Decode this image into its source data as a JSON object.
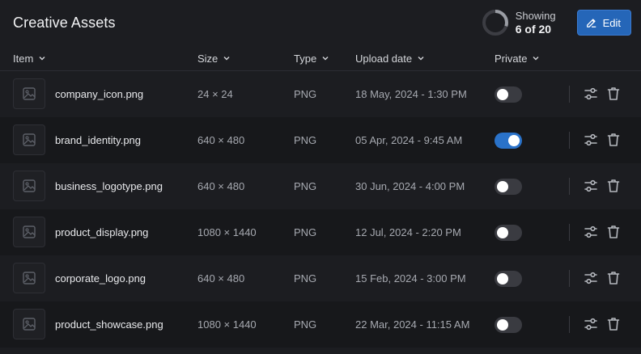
{
  "header": {
    "title": "Creative Assets",
    "progress_label": "Showing",
    "progress_value": "6 of 20",
    "progress_fraction": 0.3,
    "edit_label": "Edit"
  },
  "columns": {
    "item": "Item",
    "size": "Size",
    "type": "Type",
    "date": "Upload date",
    "private": "Private"
  },
  "colors": {
    "accent": "#2566b8",
    "toggle_on": "#2a72c9"
  },
  "rows": [
    {
      "name": "company_icon.png",
      "size": "24 × 24",
      "type": "PNG",
      "date": "18 May, 2024 - 1:30 PM",
      "private": false
    },
    {
      "name": "brand_identity.png",
      "size": "640 × 480",
      "type": "PNG",
      "date": "05 Apr, 2024 - 9:45 AM",
      "private": true
    },
    {
      "name": "business_logotype.png",
      "size": "640 × 480",
      "type": "PNG",
      "date": "30 Jun, 2024 - 4:00 PM",
      "private": false
    },
    {
      "name": "product_display.png",
      "size": "1080 × 1440",
      "type": "PNG",
      "date": "12 Jul, 2024 - 2:20 PM",
      "private": false
    },
    {
      "name": "corporate_logo.png",
      "size": "640 × 480",
      "type": "PNG",
      "date": "15 Feb, 2024 - 3:00 PM",
      "private": false
    },
    {
      "name": "product_showcase.png",
      "size": "1080 × 1440",
      "type": "PNG",
      "date": "22 Mar, 2024 - 11:15 AM",
      "private": false
    }
  ]
}
